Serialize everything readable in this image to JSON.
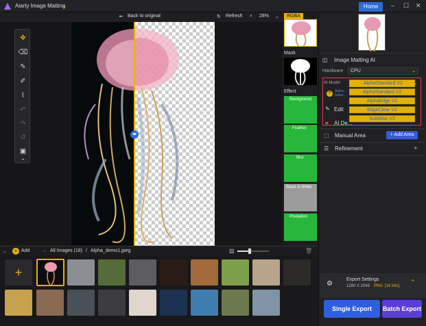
{
  "app": {
    "title": "Aiarty Image Matting",
    "home_label": "Home",
    "min": "–",
    "max": "☐",
    "close": "✕"
  },
  "canvas_toolbar": {
    "back": "Back to original",
    "refresh": "Refresh",
    "zoom": "28%"
  },
  "thumbs": {
    "rgba": "RGBA",
    "mask": "Mask",
    "effect": "Effect",
    "effects": [
      "Background",
      "Feather",
      "Blur",
      "Black & White",
      "Pixelation"
    ]
  },
  "panel": {
    "section_title": "Image Matting AI",
    "hardware_label": "Hardware",
    "hardware_value": "CPU",
    "ai_model_label": "AI Model",
    "ai_model_value": "AlphaStandard  V2",
    "hint_text": "Alpha... better...",
    "edit_label": "Edit",
    "ai_detect_label": "AI De...",
    "manual_area_label": "Manual Area",
    "add_area_label": "+ Add Area",
    "refinement_label": "Refinement",
    "model_options": [
      "AlphaStandard  V2",
      "AlphaEdge  V2",
      "EdgeClear  V2",
      "SolidMat  V2"
    ]
  },
  "export": {
    "title": "Export Settings",
    "resolution": "1280 X 2048",
    "format": "PNG",
    "bits": "[16 bits]",
    "single_label": "Single Export",
    "batch_label": "Batch Export"
  },
  "filmbar": {
    "add_label": "Add",
    "crumb_all": "All Images (18)",
    "crumb_sep": "/",
    "crumb_file": "Alpha_demo1.jpeg"
  },
  "colors": {
    "accent": "#e3b20a",
    "blue": "#2a6bd6",
    "green": "#27b83b",
    "highlight_border": "#e03a4a"
  }
}
